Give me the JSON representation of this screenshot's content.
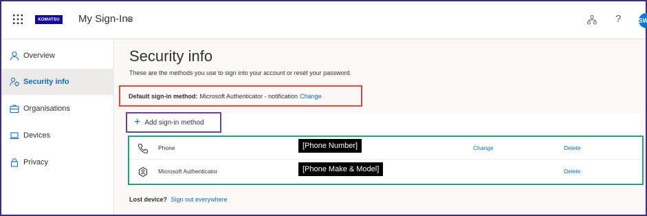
{
  "header": {
    "logo_text": "KOMATSU",
    "app_title": "My Sign-Ins",
    "help_glyph": "?",
    "avatar_initials": "SW",
    "icons": [
      "waffle-icon",
      "chevron-down-icon",
      "organization-icon",
      "help-icon"
    ]
  },
  "sidebar": {
    "items": [
      {
        "label": "Overview",
        "icon": "person-icon",
        "active": false
      },
      {
        "label": "Security info",
        "icon": "security-person-icon",
        "active": true
      },
      {
        "label": "Organisations",
        "icon": "briefcase-icon",
        "active": false
      },
      {
        "label": "Devices",
        "icon": "laptop-icon",
        "active": false
      },
      {
        "label": "Privacy",
        "icon": "lock-icon",
        "active": false
      }
    ]
  },
  "main": {
    "title": "Security info",
    "description": "These are the methods you use to sign into your account or reset your password.",
    "default_method": {
      "label": "Default sign-in method:",
      "value": "Microsoft Authenticator - notification",
      "change_link": "Change"
    },
    "add_method_label": "Add sign-in method",
    "methods": [
      {
        "name": "Phone",
        "detail": "[Phone Number]",
        "change": "Change",
        "delete": "Delete",
        "icon": "phone-icon"
      },
      {
        "name": "Microsoft Authenticator",
        "detail": "[Phone Make & Model]",
        "change": "",
        "delete": "Delete",
        "icon": "authenticator-icon"
      }
    ],
    "lost_device": {
      "label": "Lost device?",
      "link": "Sign out everywhere"
    }
  },
  "colors": {
    "accent": "#0f6cbd",
    "avatar_bg": "#0078d4",
    "logo_bg": "#140a9a",
    "highlight_red": "#e0473b",
    "highlight_purple": "#6b3fa0",
    "highlight_green": "#1aa37c",
    "active_nav_bg": "#edebe9"
  }
}
